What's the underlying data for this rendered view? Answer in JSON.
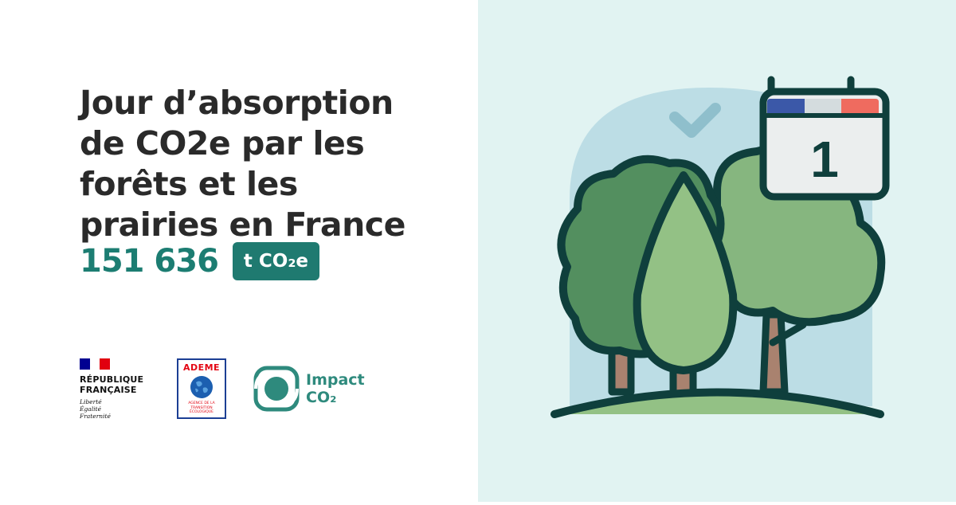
{
  "title": "Jour d’absorption de CO2e par les forêts et les prairies en France",
  "value": "151 636",
  "unit": "t CO₂e",
  "logos": {
    "republique": {
      "line1": "RÉPUBLIQUE",
      "line2": "FRANÇAISE",
      "motto1": "Liberté",
      "motto2": "Égalité",
      "motto3": "Fraternité"
    },
    "ademe": {
      "name": "ADEME",
      "sub1": "AGENCE DE LA",
      "sub2": "TRANSITION",
      "sub3": "ÉCOLOGIQUE"
    },
    "impact": {
      "line1": "Impact",
      "line2": "CO₂"
    }
  },
  "illustration": {
    "calendar_number": "1",
    "icons": [
      "calendar-icon",
      "checkmark-icon",
      "tree-icon"
    ]
  },
  "colors": {
    "accent": "#1f7a70",
    "panel_bg": "#e1f3f2",
    "title_text": "#2a2a2a"
  }
}
